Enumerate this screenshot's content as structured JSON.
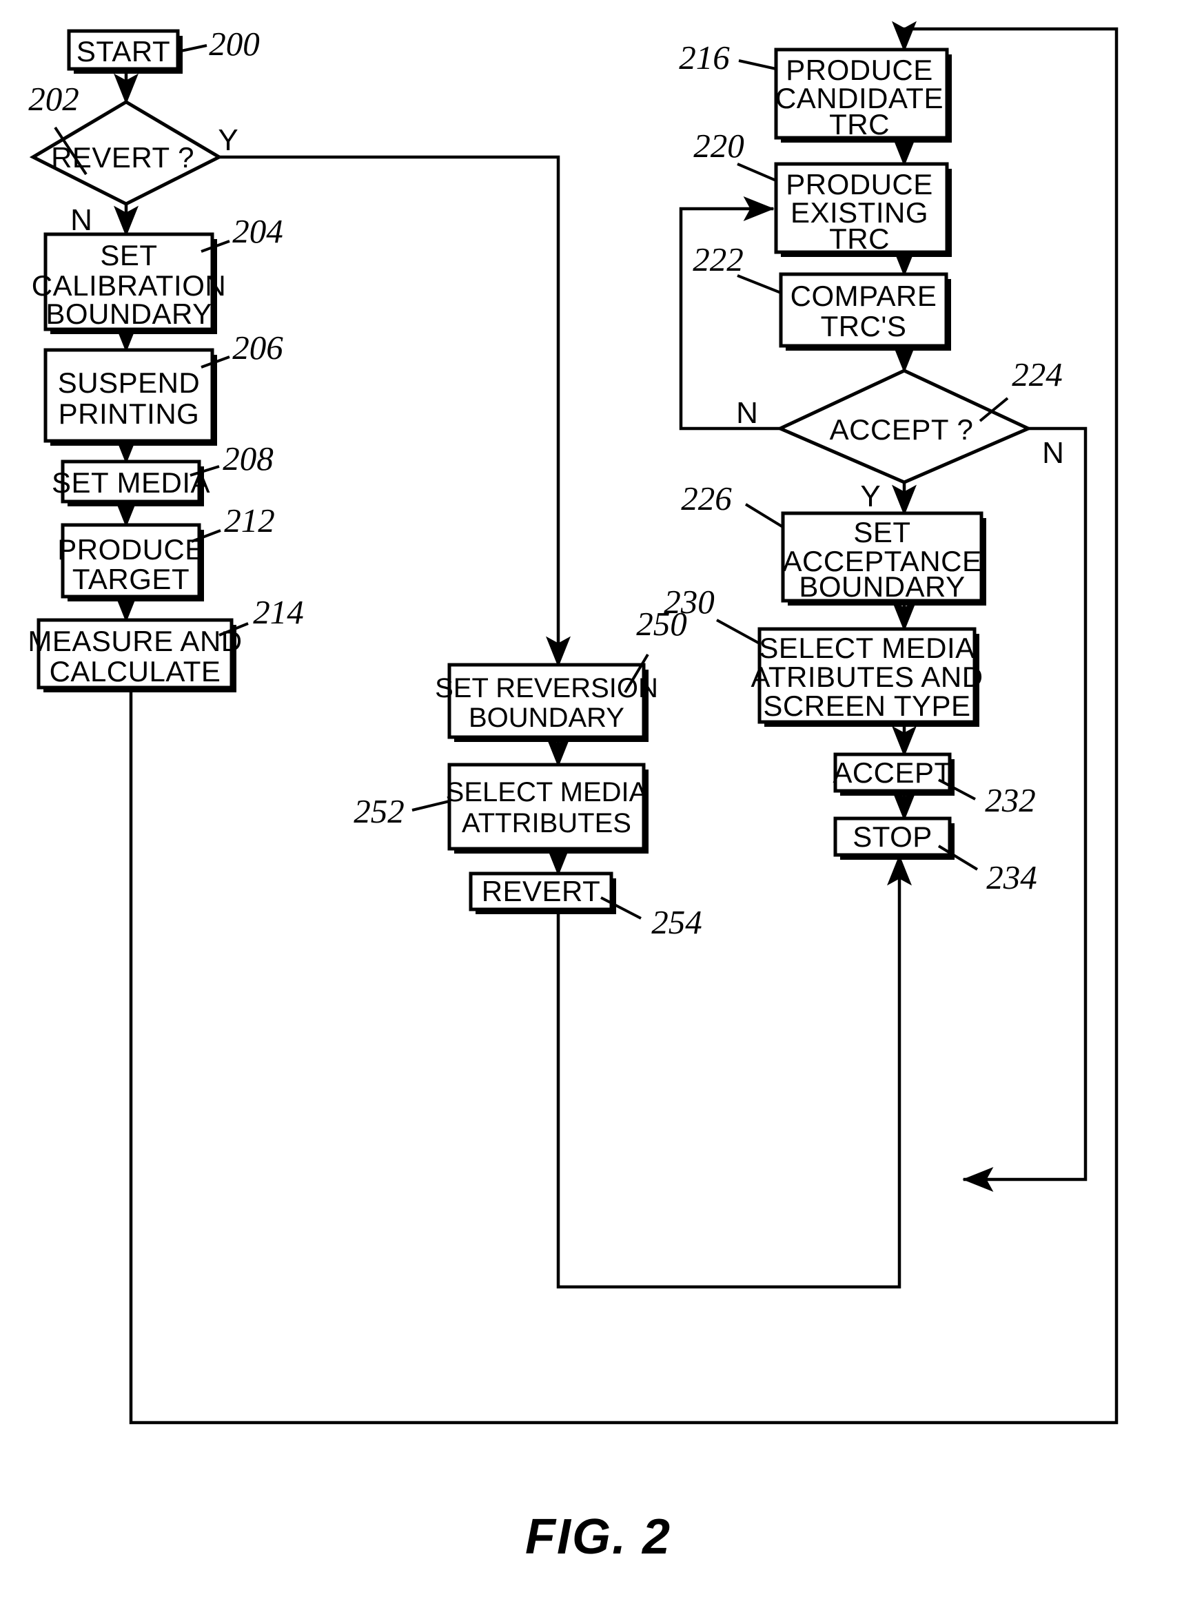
{
  "figure": {
    "caption": "FIG. 2",
    "type": "patent-flowchart"
  },
  "nodes": {
    "start": {
      "ref": "200",
      "label_l1": "START"
    },
    "revert_decision": {
      "ref": "202",
      "label_l1": "REVERT ?"
    },
    "set_calibration": {
      "ref": "204",
      "label_l1": "SET",
      "label_l2": "CALIBRATION",
      "label_l3": "BOUNDARY"
    },
    "suspend_printing": {
      "ref": "206",
      "label_l1": "SUSPEND",
      "label_l2": "PRINTING"
    },
    "set_media": {
      "ref": "208",
      "label_l1": "SET MEDIA"
    },
    "produce_target": {
      "ref": "212",
      "label_l1": "PRODUCE",
      "label_l2": "TARGET"
    },
    "measure_calculate": {
      "ref": "214",
      "label_l1": "MEASURE AND",
      "label_l2": "CALCULATE"
    },
    "produce_candidate": {
      "ref": "216",
      "label_l1": "PRODUCE",
      "label_l2": "CANDIDATE",
      "label_l3": "TRC"
    },
    "produce_existing": {
      "ref": "220",
      "label_l1": "PRODUCE",
      "label_l2": "EXISTING",
      "label_l3": "TRC"
    },
    "compare_trcs": {
      "ref": "222",
      "label_l1": "COMPARE",
      "label_l2": "TRC'S"
    },
    "accept_decision": {
      "ref": "224",
      "label_l1": "ACCEPT ?"
    },
    "set_acceptance": {
      "ref": "226",
      "label_l1": "SET",
      "label_l2": "ACCEPTANCE",
      "label_l3": "BOUNDARY"
    },
    "select_media_screen": {
      "ref": "230",
      "label_l1": "SELECT MEDIA",
      "label_l2": "ATRIBUTES AND",
      "label_l3": "SCREEN TYPE"
    },
    "accept": {
      "ref": "232",
      "label_l1": "ACCEPT"
    },
    "stop": {
      "ref": "234",
      "label_l1": "STOP"
    },
    "set_reversion": {
      "ref": "250",
      "label_l1": "SET REVERSION",
      "label_l2": "BOUNDARY"
    },
    "select_media_attrs": {
      "ref": "252",
      "label_l1": "SELECT MEDIA",
      "label_l2": "ATTRIBUTES"
    },
    "revert": {
      "ref": "254",
      "label_l1": "REVERT"
    }
  },
  "branch_labels": {
    "revert_yes": "Y",
    "revert_no": "N",
    "accept_yes": "Y",
    "accept_no_left": "N",
    "accept_no_right": "N"
  },
  "colors": {
    "ink": "#000000",
    "paper": "#ffffff"
  }
}
